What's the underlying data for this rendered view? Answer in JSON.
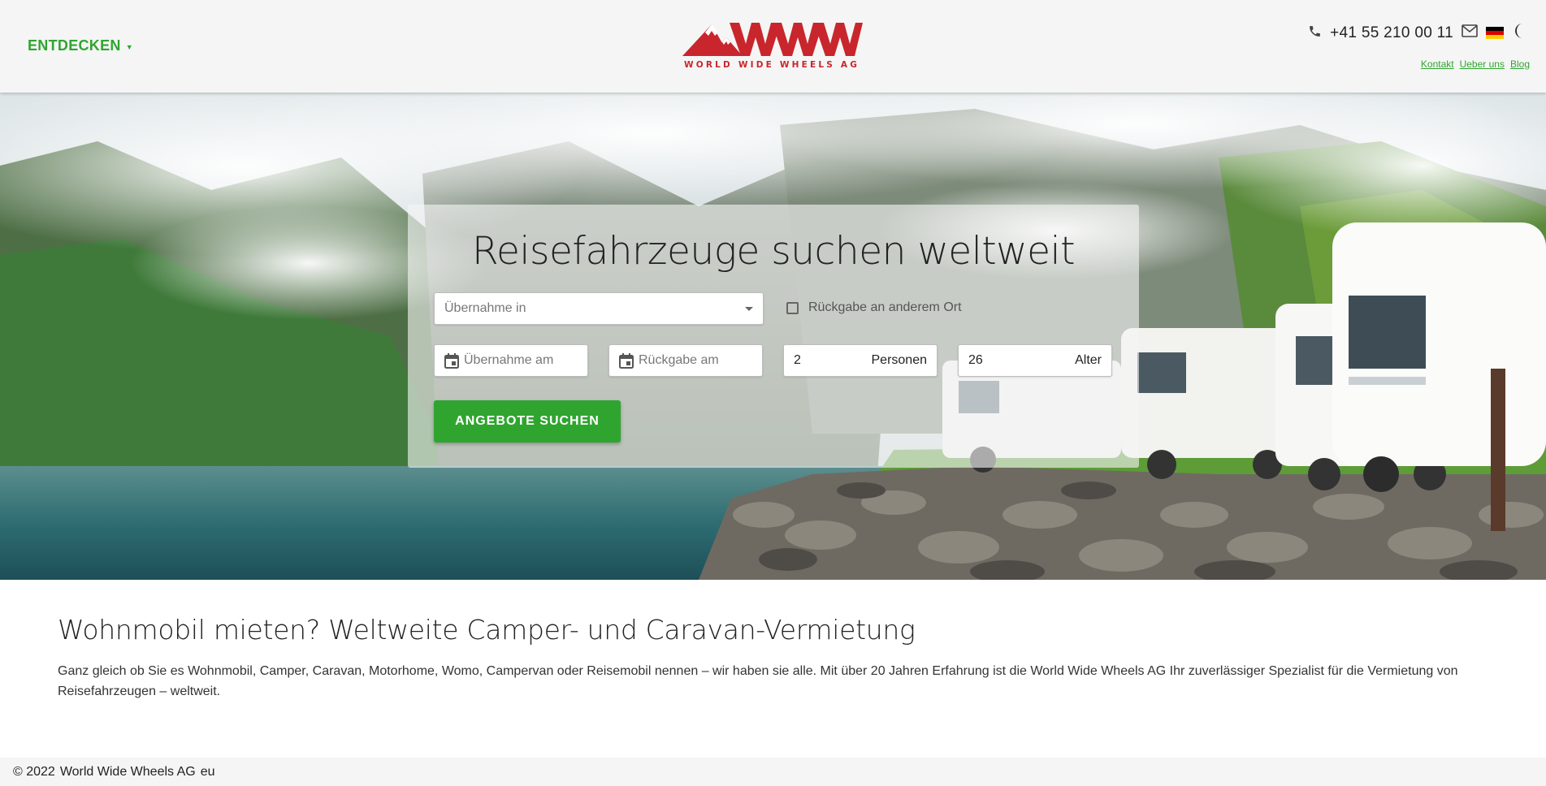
{
  "header": {
    "explore_label": "ENTDECKEN",
    "logo_text": "WORLD WIDE WHEELS AG",
    "phone": "+41 55 210 00 11",
    "links": [
      "Kontakt",
      "Ueber uns",
      "Blog"
    ],
    "icons": [
      "phone-icon",
      "mail-icon",
      "german-flag-icon",
      "dark-mode-moon-icon"
    ]
  },
  "search": {
    "title": "Reisefahrzeuge suchen weltweit",
    "pickup_location_placeholder": "Übernahme in",
    "return_other_label": "Rückgabe an anderem Ort",
    "pickup_date_placeholder": "Übernahme am",
    "return_date_placeholder": "Rückgabe am",
    "persons_value": "2",
    "persons_unit": "Personen",
    "age_value": "26",
    "age_unit": "Alter",
    "button_label": "ANGEBOTE SUCHEN"
  },
  "content": {
    "title": "Wohnmobil mieten? Weltweite Camper- und Caravan-Vermietung",
    "text": "Ganz gleich ob Sie es Wohnmobil, Camper, Caravan, Motorhome, Womo, Campervan oder Reisemobil nennen – wir haben sie alle. Mit über 20 Jahren Erfahrung ist die World Wide Wheels AG Ihr zuverlässiger Spezialist für die Vermietung von Reisefahrzeugen – weltweit."
  },
  "footer": {
    "copyright": "© 2022",
    "company": "World Wide Wheels AG",
    "region": "eu"
  },
  "colors": {
    "accent_green": "#2fa52f",
    "brand_red": "#c8262c",
    "header_bg": "#f5f5f5"
  }
}
